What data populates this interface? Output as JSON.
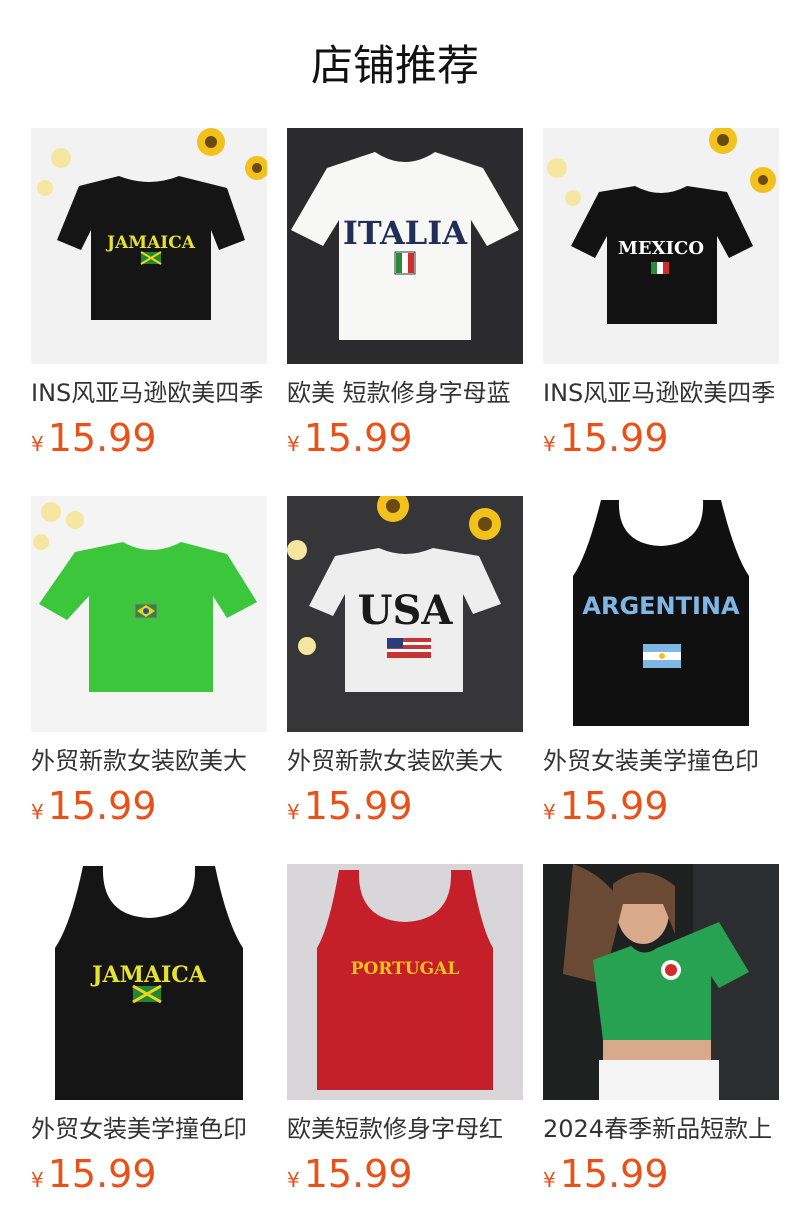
{
  "section_title": "店铺推荐",
  "colors": {
    "price": "#e8521a",
    "title": "#111111",
    "name": "#333333"
  },
  "products": [
    {
      "name": "INS风亚马逊欧美四季",
      "currency": "¥",
      "price": "15.99",
      "image": "black-jamaica-tee"
    },
    {
      "name": "欧美 短款修身字母蓝",
      "currency": "¥",
      "price": "15.99",
      "image": "white-italia-tee"
    },
    {
      "name": "INS风亚马逊欧美四季",
      "currency": "¥",
      "price": "15.99",
      "image": "black-mexico-tee"
    },
    {
      "name": "外贸新款女装欧美大",
      "currency": "¥",
      "price": "15.99",
      "image": "green-brazil-tee"
    },
    {
      "name": "外贸新款女装欧美大",
      "currency": "¥",
      "price": "15.99",
      "image": "white-usa-tee"
    },
    {
      "name": "外贸女装美学撞色印",
      "currency": "¥",
      "price": "15.99",
      "image": "black-argentina-tank"
    },
    {
      "name": "外贸女装美学撞色印",
      "currency": "¥",
      "price": "15.99",
      "image": "black-jamaica-tank"
    },
    {
      "name": "欧美短款修身字母红",
      "currency": "¥",
      "price": "15.99",
      "image": "red-portugal-tank"
    },
    {
      "name": "2024春季新品短款上",
      "currency": "¥",
      "price": "15.99",
      "image": "green-jersey-photo"
    }
  ],
  "shirt_prints": [
    "JAMAICA",
    "ITALIA",
    "MEXICO",
    "",
    "USA",
    "ARGENTINA",
    "JAMAICA",
    "PORTUGAL",
    ""
  ]
}
